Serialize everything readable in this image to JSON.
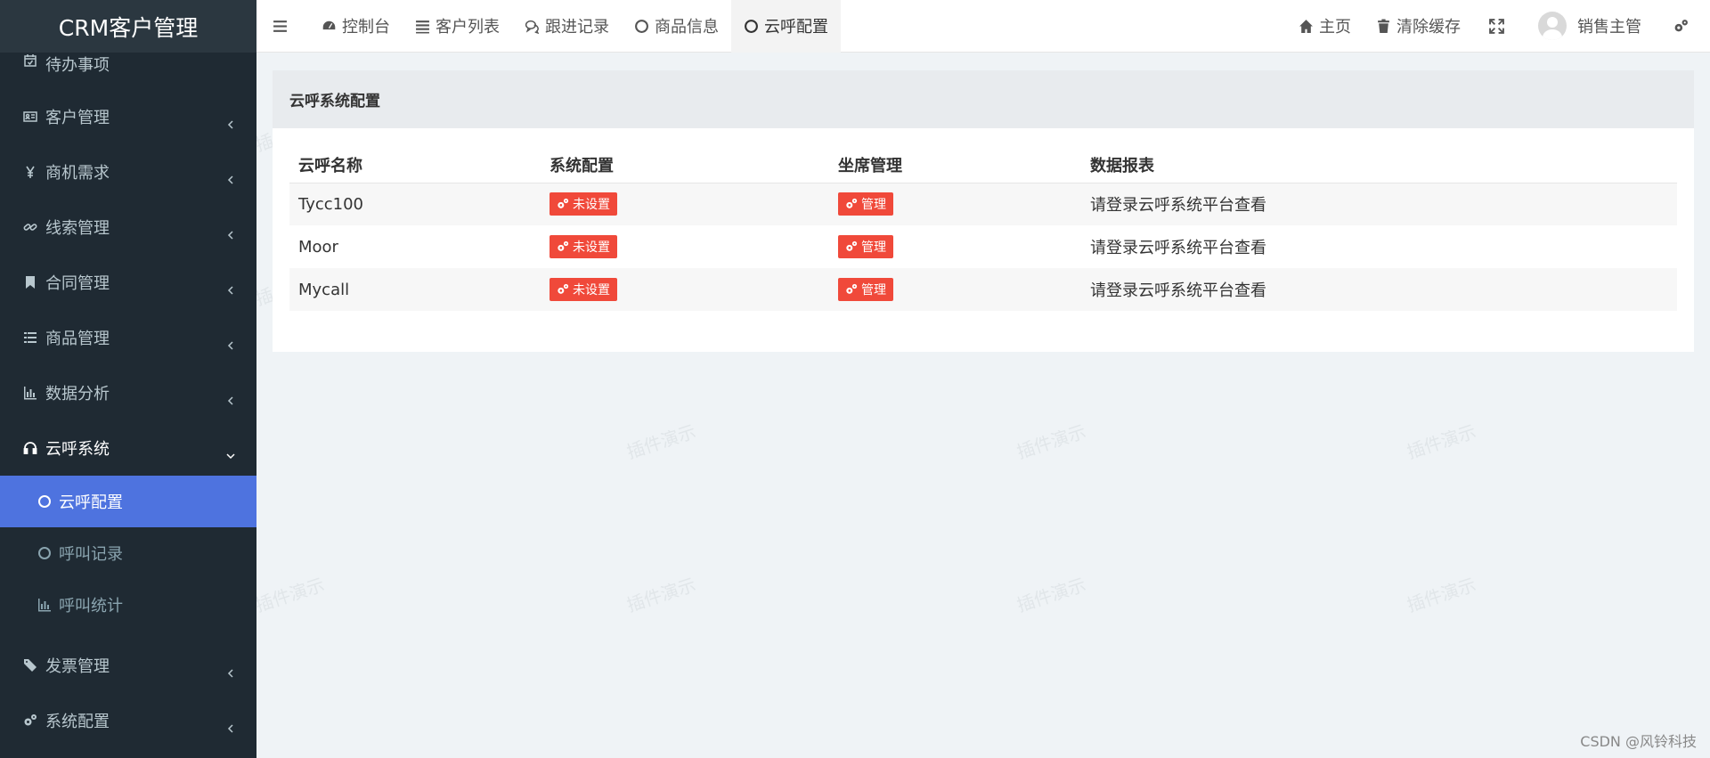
{
  "brand": "CRM客户管理",
  "sidebar": {
    "items": [
      {
        "label": "待办事项",
        "icon": "calendar-check-icon"
      },
      {
        "label": "客户管理",
        "icon": "id-card-icon"
      },
      {
        "label": "商机需求",
        "icon": "yen-icon"
      },
      {
        "label": "线索管理",
        "icon": "link-icon"
      },
      {
        "label": "合同管理",
        "icon": "bookmark-icon"
      },
      {
        "label": "商品管理",
        "icon": "list-icon"
      },
      {
        "label": "数据分析",
        "icon": "bar-chart-icon"
      },
      {
        "label": "云呼系统",
        "icon": "headset-icon"
      },
      {
        "label": "发票管理",
        "icon": "ticket-icon"
      },
      {
        "label": "系统配置",
        "icon": "gears-icon"
      }
    ],
    "subitems": [
      {
        "label": "云呼配置",
        "icon": "circle-icon"
      },
      {
        "label": "呼叫记录",
        "icon": "circle-icon"
      },
      {
        "label": "呼叫统计",
        "icon": "bar-chart-icon"
      }
    ]
  },
  "topbar": {
    "tabs": [
      {
        "label": "控制台",
        "icon": "dashboard-icon"
      },
      {
        "label": "客户列表",
        "icon": "list-icon"
      },
      {
        "label": "跟进记录",
        "icon": "comments-icon"
      },
      {
        "label": "商品信息",
        "icon": "circle-icon"
      },
      {
        "label": "云呼配置",
        "icon": "circle-icon"
      }
    ],
    "home": "主页",
    "clear_cache": "清除缓存",
    "user": "销售主管"
  },
  "panel": {
    "title": "云呼系统配置",
    "columns": [
      "云呼名称",
      "系统配置",
      "坐席管理",
      "数据报表"
    ],
    "rows": [
      {
        "name": "Tycc100",
        "config": "未设置",
        "seat": "管理",
        "report": "请登录云呼系统平台查看"
      },
      {
        "name": "Moor",
        "config": "未设置",
        "seat": "管理",
        "report": "请登录云呼系统平台查看"
      },
      {
        "name": "Mycall",
        "config": "未设置",
        "seat": "管理",
        "report": "请登录云呼系统平台查看"
      }
    ]
  },
  "watermark": "插件演示",
  "credit": "CSDN @风铃科技",
  "colors": {
    "sidebar": "#1f2a33",
    "active": "#4e73df",
    "danger": "#f0493a"
  }
}
